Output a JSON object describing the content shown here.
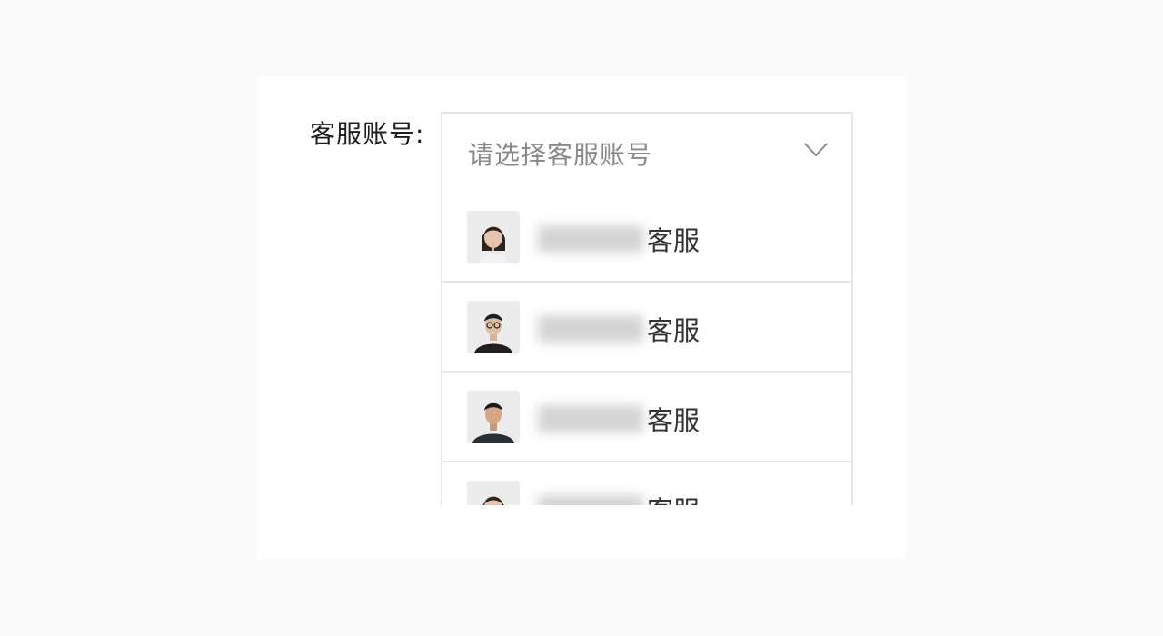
{
  "form": {
    "label": "客服账号:",
    "select": {
      "placeholder": "请选择客服账号",
      "icon": "chevron-down-icon"
    },
    "options": [
      {
        "name_suffix": "客服",
        "name_obscured": true,
        "avatar": "woman-avatar"
      },
      {
        "name_suffix": "客服",
        "name_obscured": true,
        "avatar": "man-glasses-avatar"
      },
      {
        "name_suffix": "客服",
        "name_obscured": true,
        "avatar": "man-avatar"
      },
      {
        "name_suffix": "客服",
        "name_obscured": true,
        "avatar": "woman-avatar"
      }
    ]
  }
}
